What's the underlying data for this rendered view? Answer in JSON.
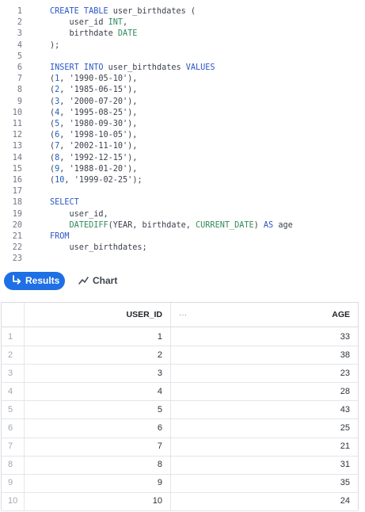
{
  "editor": {
    "lines": [
      {
        "n": "1",
        "tokens": [
          {
            "t": "CREATE TABLE ",
            "k": "kw"
          },
          {
            "t": "user_birthdates (",
            "k": "pl"
          }
        ]
      },
      {
        "n": "2",
        "tokens": [
          {
            "t": "    user_id ",
            "k": "pl"
          },
          {
            "t": "INT",
            "k": "ty"
          },
          {
            "t": ",",
            "k": "pl"
          }
        ]
      },
      {
        "n": "3",
        "tokens": [
          {
            "t": "    birthdate ",
            "k": "pl"
          },
          {
            "t": "DATE",
            "k": "ty"
          }
        ]
      },
      {
        "n": "4",
        "tokens": [
          {
            "t": ");",
            "k": "pl"
          }
        ]
      },
      {
        "n": "5",
        "tokens": []
      },
      {
        "n": "6",
        "tokens": [
          {
            "t": "INSERT INTO ",
            "k": "kw"
          },
          {
            "t": "user_birthdates ",
            "k": "pl"
          },
          {
            "t": "VALUES",
            "k": "kw"
          }
        ]
      },
      {
        "n": "7",
        "tokens": [
          {
            "t": "(",
            "k": "pl"
          },
          {
            "t": "1",
            "k": "num"
          },
          {
            "t": ", ",
            "k": "pl"
          },
          {
            "t": "'1990-05-10'",
            "k": "str"
          },
          {
            "t": "),",
            "k": "pl"
          }
        ]
      },
      {
        "n": "8",
        "tokens": [
          {
            "t": "(",
            "k": "pl"
          },
          {
            "t": "2",
            "k": "num"
          },
          {
            "t": ", ",
            "k": "pl"
          },
          {
            "t": "'1985-06-15'",
            "k": "str"
          },
          {
            "t": "),",
            "k": "pl"
          }
        ]
      },
      {
        "n": "9",
        "tokens": [
          {
            "t": "(",
            "k": "pl"
          },
          {
            "t": "3",
            "k": "num"
          },
          {
            "t": ", ",
            "k": "pl"
          },
          {
            "t": "'2000-07-20'",
            "k": "str"
          },
          {
            "t": "),",
            "k": "pl"
          }
        ]
      },
      {
        "n": "10",
        "tokens": [
          {
            "t": "(",
            "k": "pl"
          },
          {
            "t": "4",
            "k": "num"
          },
          {
            "t": ", ",
            "k": "pl"
          },
          {
            "t": "'1995-08-25'",
            "k": "str"
          },
          {
            "t": "),",
            "k": "pl"
          }
        ]
      },
      {
        "n": "11",
        "tokens": [
          {
            "t": "(",
            "k": "pl"
          },
          {
            "t": "5",
            "k": "num"
          },
          {
            "t": ", ",
            "k": "pl"
          },
          {
            "t": "'1980-09-30'",
            "k": "str"
          },
          {
            "t": "),",
            "k": "pl"
          }
        ]
      },
      {
        "n": "12",
        "tokens": [
          {
            "t": "(",
            "k": "pl"
          },
          {
            "t": "6",
            "k": "num"
          },
          {
            "t": ", ",
            "k": "pl"
          },
          {
            "t": "'1998-10-05'",
            "k": "str"
          },
          {
            "t": "),",
            "k": "pl"
          }
        ]
      },
      {
        "n": "13",
        "tokens": [
          {
            "t": "(",
            "k": "pl"
          },
          {
            "t": "7",
            "k": "num"
          },
          {
            "t": ", ",
            "k": "pl"
          },
          {
            "t": "'2002-11-10'",
            "k": "str"
          },
          {
            "t": "),",
            "k": "pl"
          }
        ]
      },
      {
        "n": "14",
        "tokens": [
          {
            "t": "(",
            "k": "pl"
          },
          {
            "t": "8",
            "k": "num"
          },
          {
            "t": ", ",
            "k": "pl"
          },
          {
            "t": "'1992-12-15'",
            "k": "str"
          },
          {
            "t": "),",
            "k": "pl"
          }
        ]
      },
      {
        "n": "15",
        "tokens": [
          {
            "t": "(",
            "k": "pl"
          },
          {
            "t": "9",
            "k": "num"
          },
          {
            "t": ", ",
            "k": "pl"
          },
          {
            "t": "'1988-01-20'",
            "k": "str"
          },
          {
            "t": "),",
            "k": "pl"
          }
        ]
      },
      {
        "n": "16",
        "tokens": [
          {
            "t": "(",
            "k": "pl"
          },
          {
            "t": "10",
            "k": "num"
          },
          {
            "t": ", ",
            "k": "pl"
          },
          {
            "t": "'1999-02-25'",
            "k": "str"
          },
          {
            "t": ");",
            "k": "pl"
          }
        ]
      },
      {
        "n": "17",
        "tokens": []
      },
      {
        "n": "18",
        "tokens": [
          {
            "t": "SELECT",
            "k": "kw"
          }
        ]
      },
      {
        "n": "19",
        "tokens": [
          {
            "t": "    user_id,",
            "k": "pl"
          }
        ]
      },
      {
        "n": "20",
        "tokens": [
          {
            "t": "    ",
            "k": "pl"
          },
          {
            "t": "DATEDIFF",
            "k": "ty"
          },
          {
            "t": "(YEAR, birthdate, ",
            "k": "pl"
          },
          {
            "t": "CURRENT_DATE",
            "k": "ty"
          },
          {
            "t": ") ",
            "k": "pl"
          },
          {
            "t": "AS",
            "k": "kw"
          },
          {
            "t": " age",
            "k": "pl"
          }
        ]
      },
      {
        "n": "21",
        "tokens": [
          {
            "t": "FROM",
            "k": "kw"
          }
        ]
      },
      {
        "n": "22",
        "tokens": [
          {
            "t": "    user_birthdates;",
            "k": "pl"
          }
        ]
      },
      {
        "n": "23",
        "tokens": []
      }
    ]
  },
  "tabs": {
    "results_label": "Results",
    "results_icon": "arrow-return-icon",
    "chart_label": "Chart",
    "chart_icon": "line-chart-icon",
    "active_color": "#1f6fe5"
  },
  "grid": {
    "columns": {
      "user_id": "USER_ID",
      "menu": "···",
      "age": "AGE"
    },
    "rows": [
      {
        "idx": "1",
        "user_id": "1",
        "age": "33"
      },
      {
        "idx": "2",
        "user_id": "2",
        "age": "38"
      },
      {
        "idx": "3",
        "user_id": "3",
        "age": "23"
      },
      {
        "idx": "4",
        "user_id": "4",
        "age": "28"
      },
      {
        "idx": "5",
        "user_id": "5",
        "age": "43"
      },
      {
        "idx": "6",
        "user_id": "6",
        "age": "25"
      },
      {
        "idx": "7",
        "user_id": "7",
        "age": "21"
      },
      {
        "idx": "8",
        "user_id": "8",
        "age": "31"
      },
      {
        "idx": "9",
        "user_id": "9",
        "age": "35"
      },
      {
        "idx": "10",
        "user_id": "10",
        "age": "24"
      }
    ]
  }
}
